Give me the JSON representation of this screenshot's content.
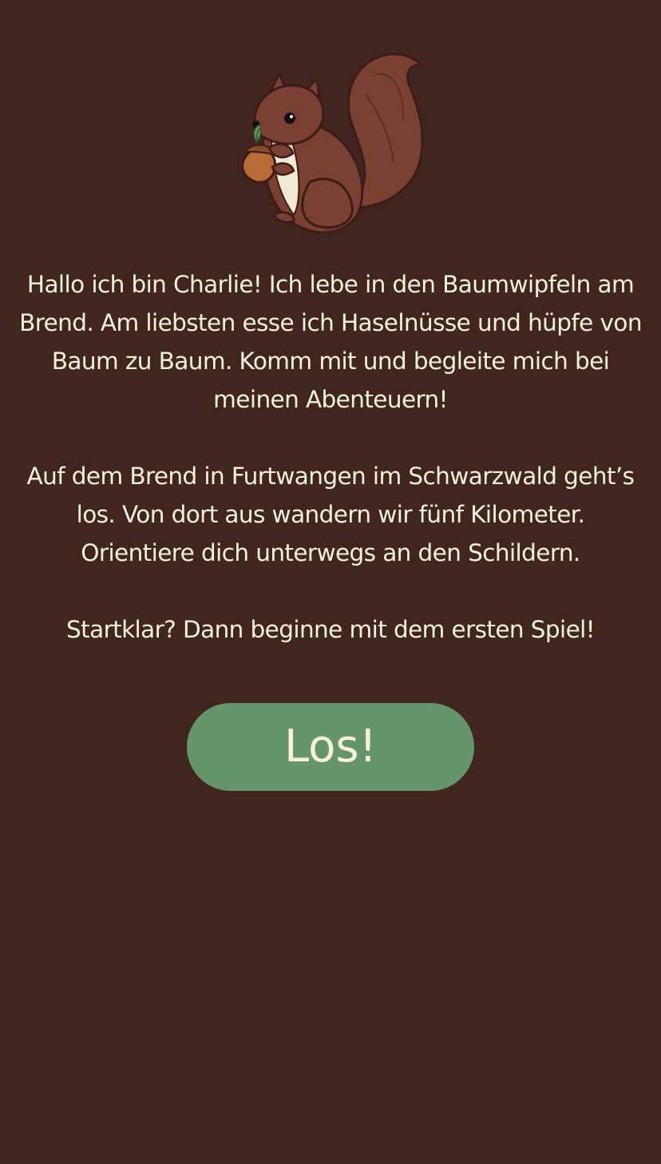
{
  "mascot": {
    "icon": "squirrel-with-hazelnut-icon"
  },
  "intro": {
    "paragraph_1": "Hallo ich bin Charlie! Ich lebe in den Baumwipfeln am Brend. Am liebsten esse ich Haselnüsse und hüpfe von Baum zu Baum. Komm mit und begleite mich bei meinen Abenteuern!",
    "paragraph_2": "Auf dem Brend in Furtwangen im Schwarzwald geht’s los. Von dort aus wandern wir fünf Kilometer. Orientiere dich unterwegs an den Schildern.",
    "paragraph_3": "Startklar? Dann beginne mit dem ersten Spiel!"
  },
  "start_button": {
    "label": "Los!"
  },
  "colors": {
    "background": "#41261f",
    "text": "#f7f1dc",
    "button": "#64966a"
  }
}
